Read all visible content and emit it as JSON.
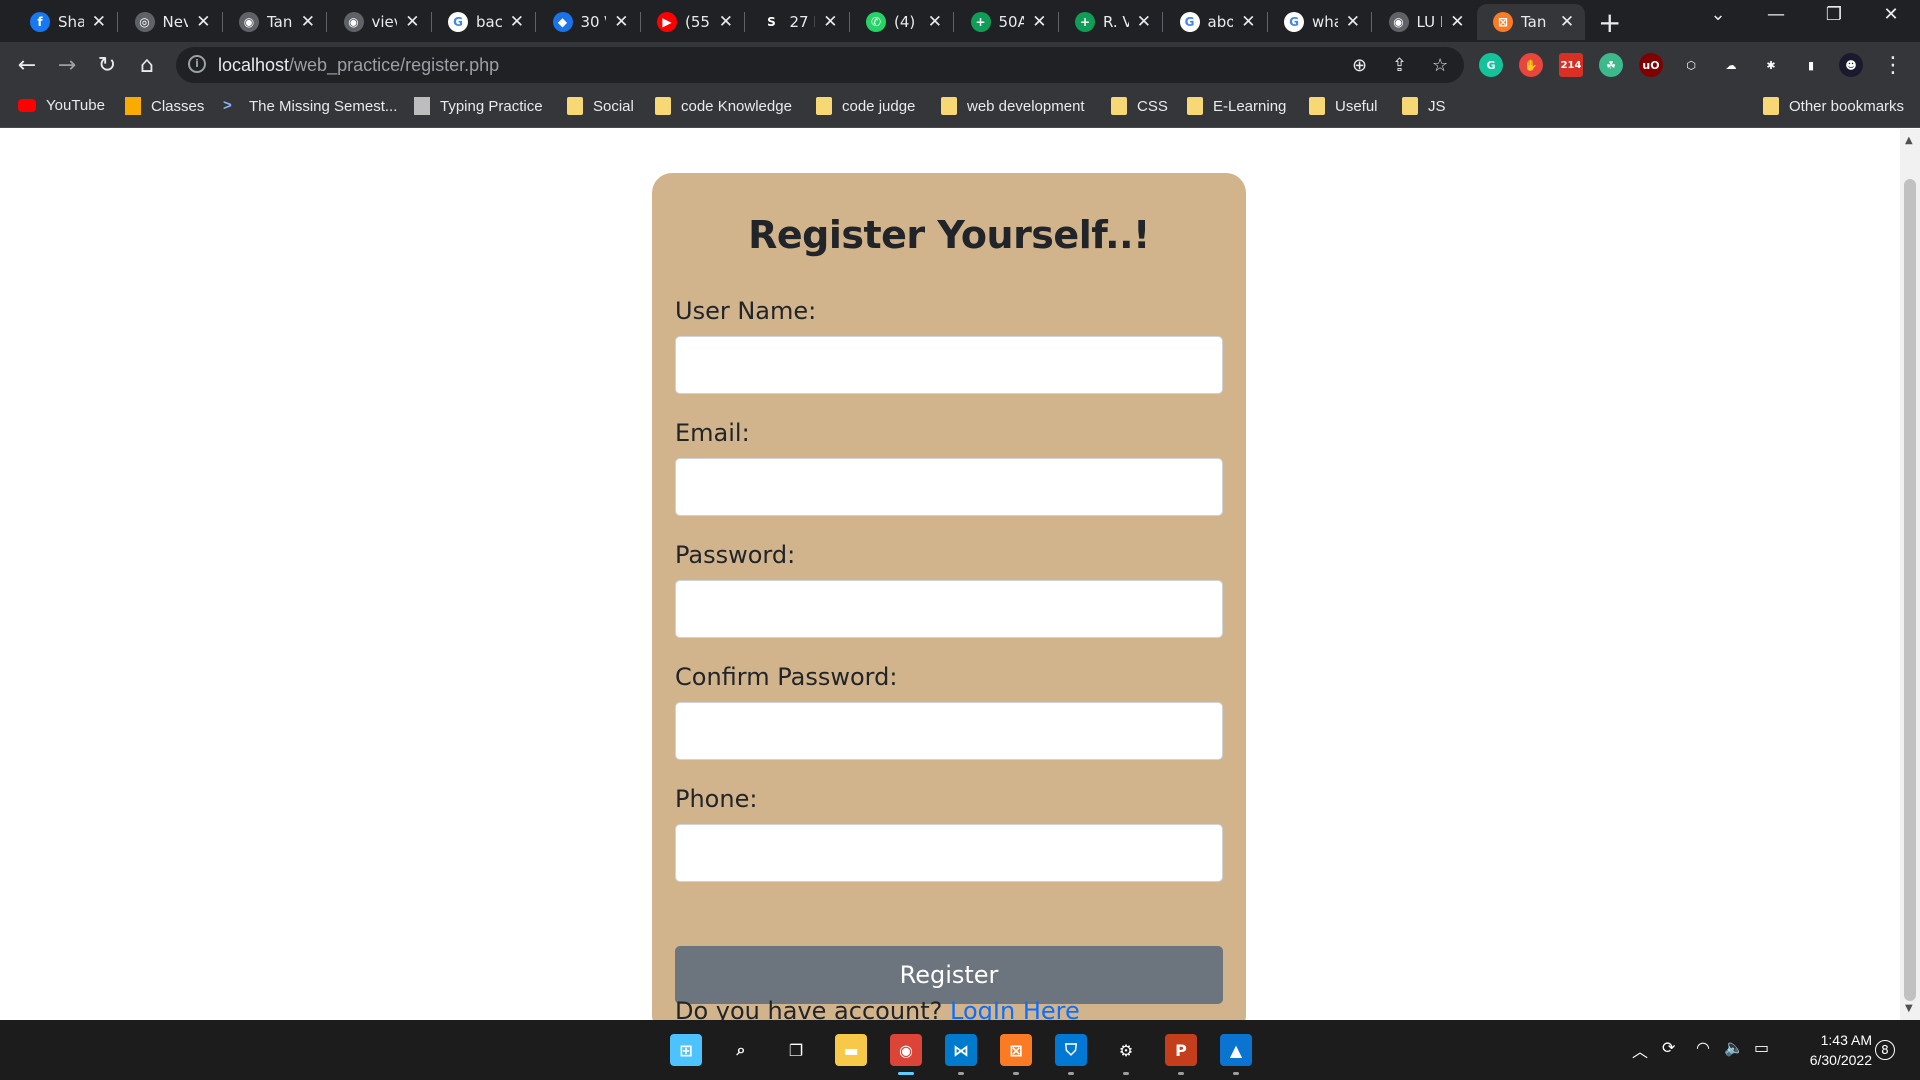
{
  "browser": {
    "tabs": [
      {
        "title": "Sha",
        "icon": "facebook-icon",
        "color": "#1877f2",
        "glyph": "f"
      },
      {
        "title": "Nev",
        "icon": "chrome-icon",
        "color": "#5f6368",
        "glyph": "◎"
      },
      {
        "title": "Tan",
        "icon": "globe-icon",
        "color": "#5f6368",
        "glyph": "◉"
      },
      {
        "title": "viev",
        "icon": "globe-icon",
        "color": "#5f6368",
        "glyph": "◉"
      },
      {
        "title": "bac",
        "icon": "google-icon",
        "color": "#ffffff",
        "glyph": "G"
      },
      {
        "title": "30 \\",
        "icon": "blue-diamond-icon",
        "color": "#1a73e8",
        "glyph": "◆"
      },
      {
        "title": "(55)",
        "icon": "youtube-icon",
        "color": "#ff0000",
        "glyph": "▶"
      },
      {
        "title": "27 E",
        "icon": "s-icon",
        "color": "#202124",
        "glyph": "S"
      },
      {
        "title": "(4) \\",
        "icon": "whatsapp-icon",
        "color": "#25d366",
        "glyph": "✆"
      },
      {
        "title": "50A",
        "icon": "sheets-icon",
        "color": "#0f9d58",
        "glyph": "+"
      },
      {
        "title": "R. V",
        "icon": "sheets-icon",
        "color": "#0f9d58",
        "glyph": "+"
      },
      {
        "title": "abo",
        "icon": "google-icon",
        "color": "#ffffff",
        "glyph": "G"
      },
      {
        "title": "wha",
        "icon": "google-icon",
        "color": "#ffffff",
        "glyph": "G"
      },
      {
        "title": "LU I",
        "icon": "globe-icon",
        "color": "#5f6368",
        "glyph": "◉"
      },
      {
        "title": "Tan",
        "icon": "xampp-icon",
        "color": "#fb7a24",
        "glyph": "⊠",
        "active": true
      }
    ],
    "new_tab": "+",
    "url_host": "localhost",
    "url_path": "/web_practice/register.php",
    "extensions": [
      {
        "icon": "grammarly-icon",
        "color": "#15c39a",
        "glyph": "G"
      },
      {
        "icon": "stop-hand-icon",
        "color": "#e8453c",
        "glyph": "✋"
      },
      {
        "icon": "gmail-counter-icon",
        "color": "#d93025",
        "glyph": "214"
      },
      {
        "icon": "brain-icon",
        "color": "#3cba8b",
        "glyph": "☘"
      },
      {
        "icon": "ublock-icon",
        "color": "#800000",
        "glyph": "uO"
      },
      {
        "icon": "cube-icon",
        "color": "#35363a",
        "glyph": "⬡"
      },
      {
        "icon": "cloud-icon",
        "color": "#35363a",
        "glyph": "☁"
      },
      {
        "icon": "puzzle-icon",
        "color": "#35363a",
        "glyph": "✱"
      },
      {
        "icon": "sidepanel-icon",
        "color": "#35363a",
        "glyph": "▮"
      },
      {
        "icon": "profile-avatar-icon",
        "color": "#1a1a2e",
        "glyph": "☻"
      }
    ]
  },
  "bookmarks": [
    {
      "label": "YouTube",
      "icon": "youtube-icon",
      "color": "#ff0000"
    },
    {
      "label": "Classes",
      "icon": "classroom-icon",
      "color": "#f9ab00"
    },
    {
      "label": "The Missing Semest...",
      "icon": "terminal-icon",
      "color": "#35363a"
    },
    {
      "label": "Typing Practice",
      "icon": "keyboard-icon",
      "color": "#bdbdbd"
    },
    {
      "label": "Social",
      "icon": "folder-icon",
      "color": "#f8d775"
    },
    {
      "label": "code Knowledge",
      "icon": "folder-icon",
      "color": "#f8d775"
    },
    {
      "label": "code judge",
      "icon": "folder-icon",
      "color": "#f8d775"
    },
    {
      "label": "web development",
      "icon": "folder-icon",
      "color": "#f8d775"
    },
    {
      "label": "CSS",
      "icon": "folder-icon",
      "color": "#f8d775"
    },
    {
      "label": "E-Learning",
      "icon": "folder-icon",
      "color": "#f8d775"
    },
    {
      "label": "Useful",
      "icon": "folder-icon",
      "color": "#f8d775"
    },
    {
      "label": "JS",
      "icon": "folder-icon",
      "color": "#f8d775"
    }
  ],
  "other_bookmarks": "Other bookmarks",
  "form": {
    "title": "Register Yourself..!",
    "fields": [
      {
        "label": "User Name:",
        "value": "",
        "placeholder": ""
      },
      {
        "label": "Email:",
        "value": "",
        "placeholder": ""
      },
      {
        "label": "Password:",
        "value": "",
        "placeholder": ""
      },
      {
        "label": "Confirm Password:",
        "value": "",
        "placeholder": ""
      },
      {
        "label": "Phone:",
        "value": "",
        "placeholder": ""
      }
    ],
    "submit_label": "Register",
    "account_prompt": "Do you have account?",
    "login_link": "LogIn Here",
    "colors": {
      "card": "#d2b48c",
      "button": "#6c757d",
      "link": "#0d6efd"
    }
  },
  "taskbar": {
    "apps": [
      {
        "icon": "windows-start-icon",
        "color": "#4cc2ff",
        "glyph": "⊞"
      },
      {
        "icon": "search-icon",
        "color": "#1c1c1c",
        "glyph": "⌕"
      },
      {
        "icon": "task-view-icon",
        "color": "#1c1c1c",
        "glyph": "❐"
      },
      {
        "icon": "file-explorer-icon",
        "color": "#f8c948",
        "glyph": "▬"
      },
      {
        "icon": "chrome-icon",
        "color": "#db4437",
        "glyph": "◉",
        "active": true
      },
      {
        "icon": "vscode-icon",
        "color": "#007acc",
        "glyph": "⋈"
      },
      {
        "icon": "xampp-icon",
        "color": "#fb7a24",
        "glyph": "⊠"
      },
      {
        "icon": "defender-icon",
        "color": "#0078d4",
        "glyph": "⛉"
      },
      {
        "icon": "settings-icon",
        "color": "#1c1c1c",
        "glyph": "⚙"
      },
      {
        "icon": "powerpoint-icon",
        "color": "#c43e1c",
        "glyph": "P"
      },
      {
        "icon": "photos-icon",
        "color": "#0b74d0",
        "glyph": "▲"
      }
    ],
    "time": "1:43 AM",
    "date": "6/30/2022",
    "notifications": "8"
  }
}
